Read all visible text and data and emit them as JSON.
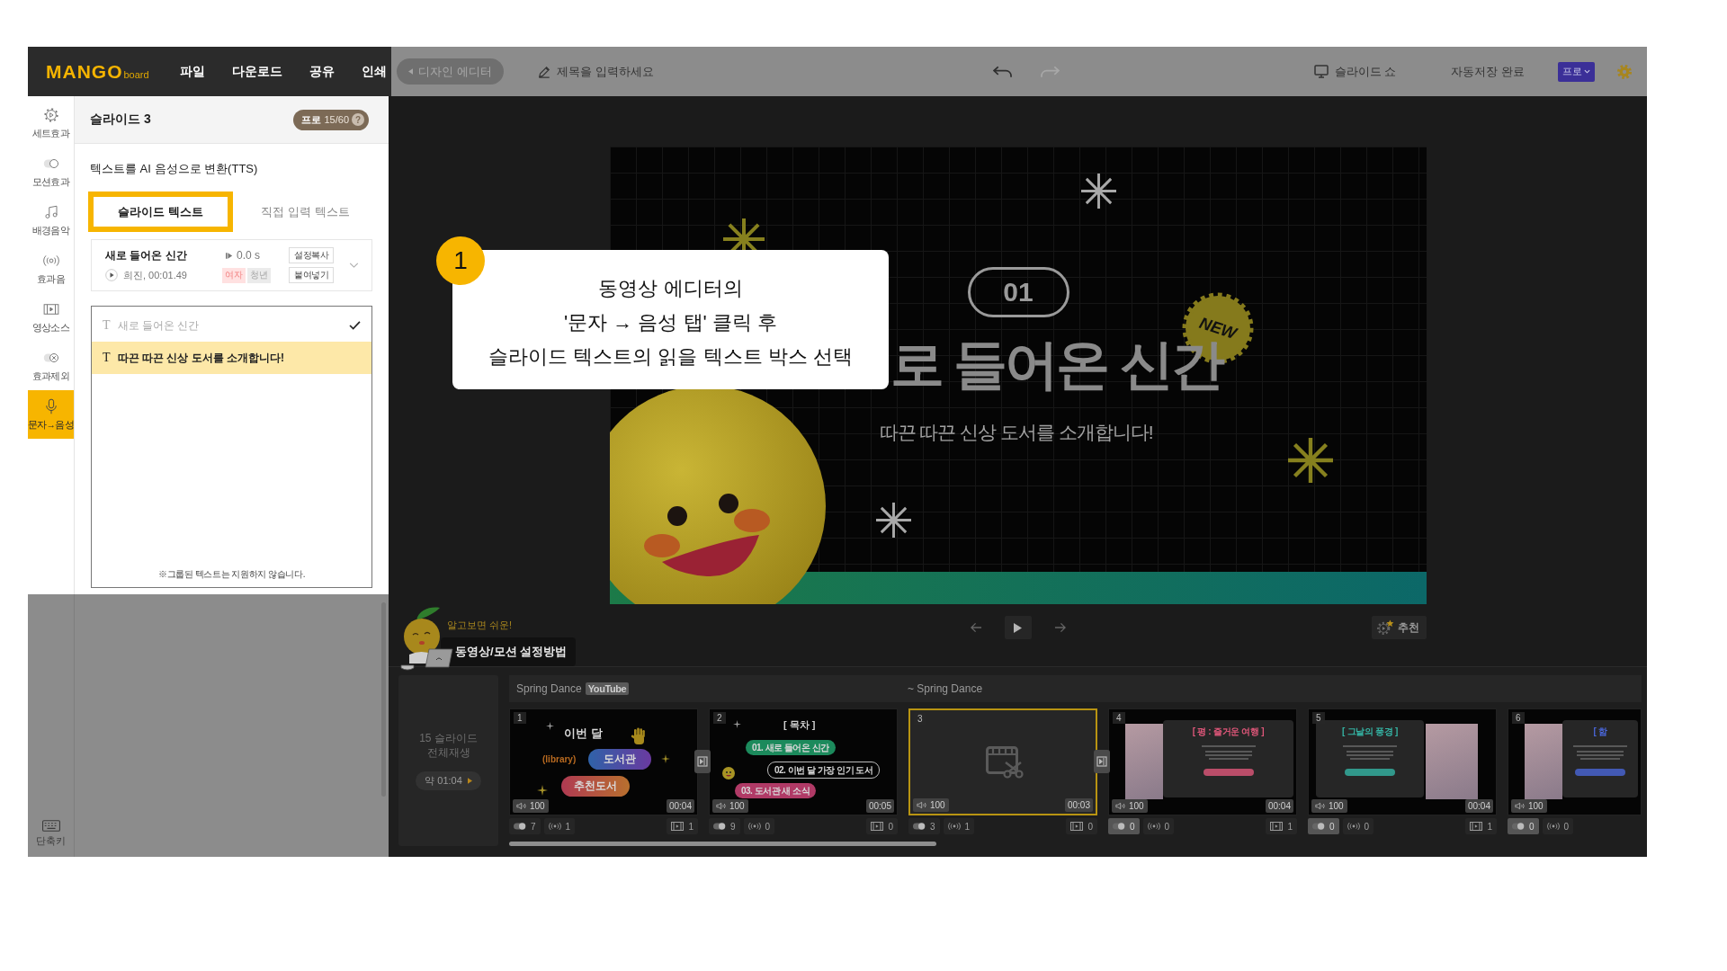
{
  "topbar": {
    "logo": "MANGO",
    "logo_suffix": "board",
    "menu": [
      "파일",
      "다운로드",
      "공유",
      "인쇄"
    ],
    "mode_button": "디자인 에디터",
    "title_field": {
      "placeholder": "제목을 입력하세요"
    },
    "history": [
      {
        "kind": "undo",
        "disabled": false
      },
      {
        "kind": "redo",
        "disabled": true
      }
    ],
    "slideshow": "슬라이드 쇼",
    "save_status": "자동저장 완료",
    "plan": "프로"
  },
  "sidebar": {
    "items": [
      {
        "kind": "set",
        "label": "세트효과",
        "selected": false
      },
      {
        "kind": "motion",
        "label": "모션효과",
        "selected": false
      },
      {
        "kind": "music",
        "label": "배경음악",
        "selected": false
      },
      {
        "kind": "sound",
        "label": "효과음",
        "selected": false
      },
      {
        "kind": "video",
        "label": "영상소스",
        "selected": false
      },
      {
        "kind": "exclude",
        "label": "효과제외",
        "selected": false
      },
      {
        "kind": "tts",
        "label": "문자→음성",
        "selected": true
      }
    ],
    "shortcut": "단축키"
  },
  "panel": {
    "title": "슬라이드 3",
    "quota": {
      "plan": "프로",
      "count": "15/60",
      "help": "?"
    },
    "heading": "텍스트를 AI 음성으로 변환(TTS)",
    "tabs": [
      {
        "label": "슬라이드 텍스트",
        "selected": true
      },
      {
        "label": "직접 입력 텍스트",
        "selected": false
      }
    ],
    "voice": {
      "title": "새로 들어온 신간",
      "info": "희진, 00:01.49",
      "delay": "0.0 s",
      "tags": [
        {
          "label": "여자",
          "color": "#ffe1e1"
        },
        {
          "label": "청년",
          "color": "#ebebeb"
        }
      ],
      "actions": [
        "설정복사",
        "붙여넣기"
      ]
    },
    "text_boxes": [
      {
        "icon": "T",
        "text": "새로 들어온 신간",
        "done": true,
        "selected": false
      },
      {
        "icon": "T",
        "text": "따끈 따끈 신상 도서를 소개합니다!",
        "done": false,
        "selected": true
      }
    ],
    "note": "※그룹된 텍스트는 지원하지 않습니다."
  },
  "canvas": {
    "slide": {
      "number": "01",
      "badge": "NEW",
      "title": "로 들어온 신간",
      "subtitle": "따끈 따끈 신상 도서를 소개합니다!"
    },
    "recommend": "추천"
  },
  "callout": {
    "step": "1",
    "lines": [
      "동영상 에디터의",
      "'문자 → 음성 탭' 클릭 후",
      "슬라이드 텍스트의 읽을 텍스트 박스 선택"
    ]
  },
  "guide": {
    "tagline": "알고보면 쉬운!",
    "button": "동영상/모션 설정방법"
  },
  "timeline": {
    "play_all": {
      "lines": [
        "15 슬라이드",
        "전체재생"
      ],
      "duration": "약 01:04"
    },
    "music": {
      "title": "Spring Dance",
      "source": "YouTube",
      "continuation": "~ Spring Dance"
    },
    "slides": [
      {
        "number": "1",
        "kind": "cover",
        "texts": [
          "이번 달",
          "(library)",
          "도서관",
          "추천도서"
        ],
        "volume": "100",
        "duration": "00:04",
        "selected": false,
        "transition": true,
        "motion": "7",
        "highlighted": false,
        "sounds": "1",
        "videos": "1"
      },
      {
        "number": "2",
        "kind": "contents",
        "texts": [
          "[ 목차 ]",
          "01. 새로 들어온 신간",
          "02. 이번 달 가장 인기 도서",
          "03. 도서관 새 소식"
        ],
        "volume": "100",
        "duration": "00:05",
        "selected": false,
        "transition": false,
        "motion": "9",
        "highlighted": false,
        "sounds": "0",
        "videos": "0"
      },
      {
        "number": "3",
        "kind": "empty",
        "volume": "100",
        "duration": "00:03",
        "selected": true,
        "transition": true,
        "motion": "3",
        "highlighted": false,
        "sounds": "1",
        "videos": "0"
      },
      {
        "number": "4",
        "kind": "book",
        "cover_right": false,
        "color": "#e0577a",
        "texts": [
          "[ 평 : 즐거운 여행 ]"
        ],
        "volume": "100",
        "duration": "00:04",
        "selected": false,
        "transition": false,
        "motion": "0",
        "highlighted": true,
        "sounds": "0",
        "videos": "1"
      },
      {
        "number": "5",
        "kind": "book",
        "cover_right": true,
        "color": "#35b5a5",
        "texts": [
          "[ 그날의 풍경 ]"
        ],
        "volume": "100",
        "duration": "00:04",
        "selected": false,
        "transition": false,
        "motion": "0",
        "highlighted": true,
        "sounds": "0",
        "videos": "1"
      },
      {
        "number": "6",
        "kind": "book",
        "cover_right": false,
        "color": "#4a66d8",
        "texts": [
          "[ 함"
        ],
        "volume": "100",
        "selected": false,
        "transition": false,
        "motion": "0",
        "highlighted": true,
        "sounds": "0"
      }
    ]
  }
}
